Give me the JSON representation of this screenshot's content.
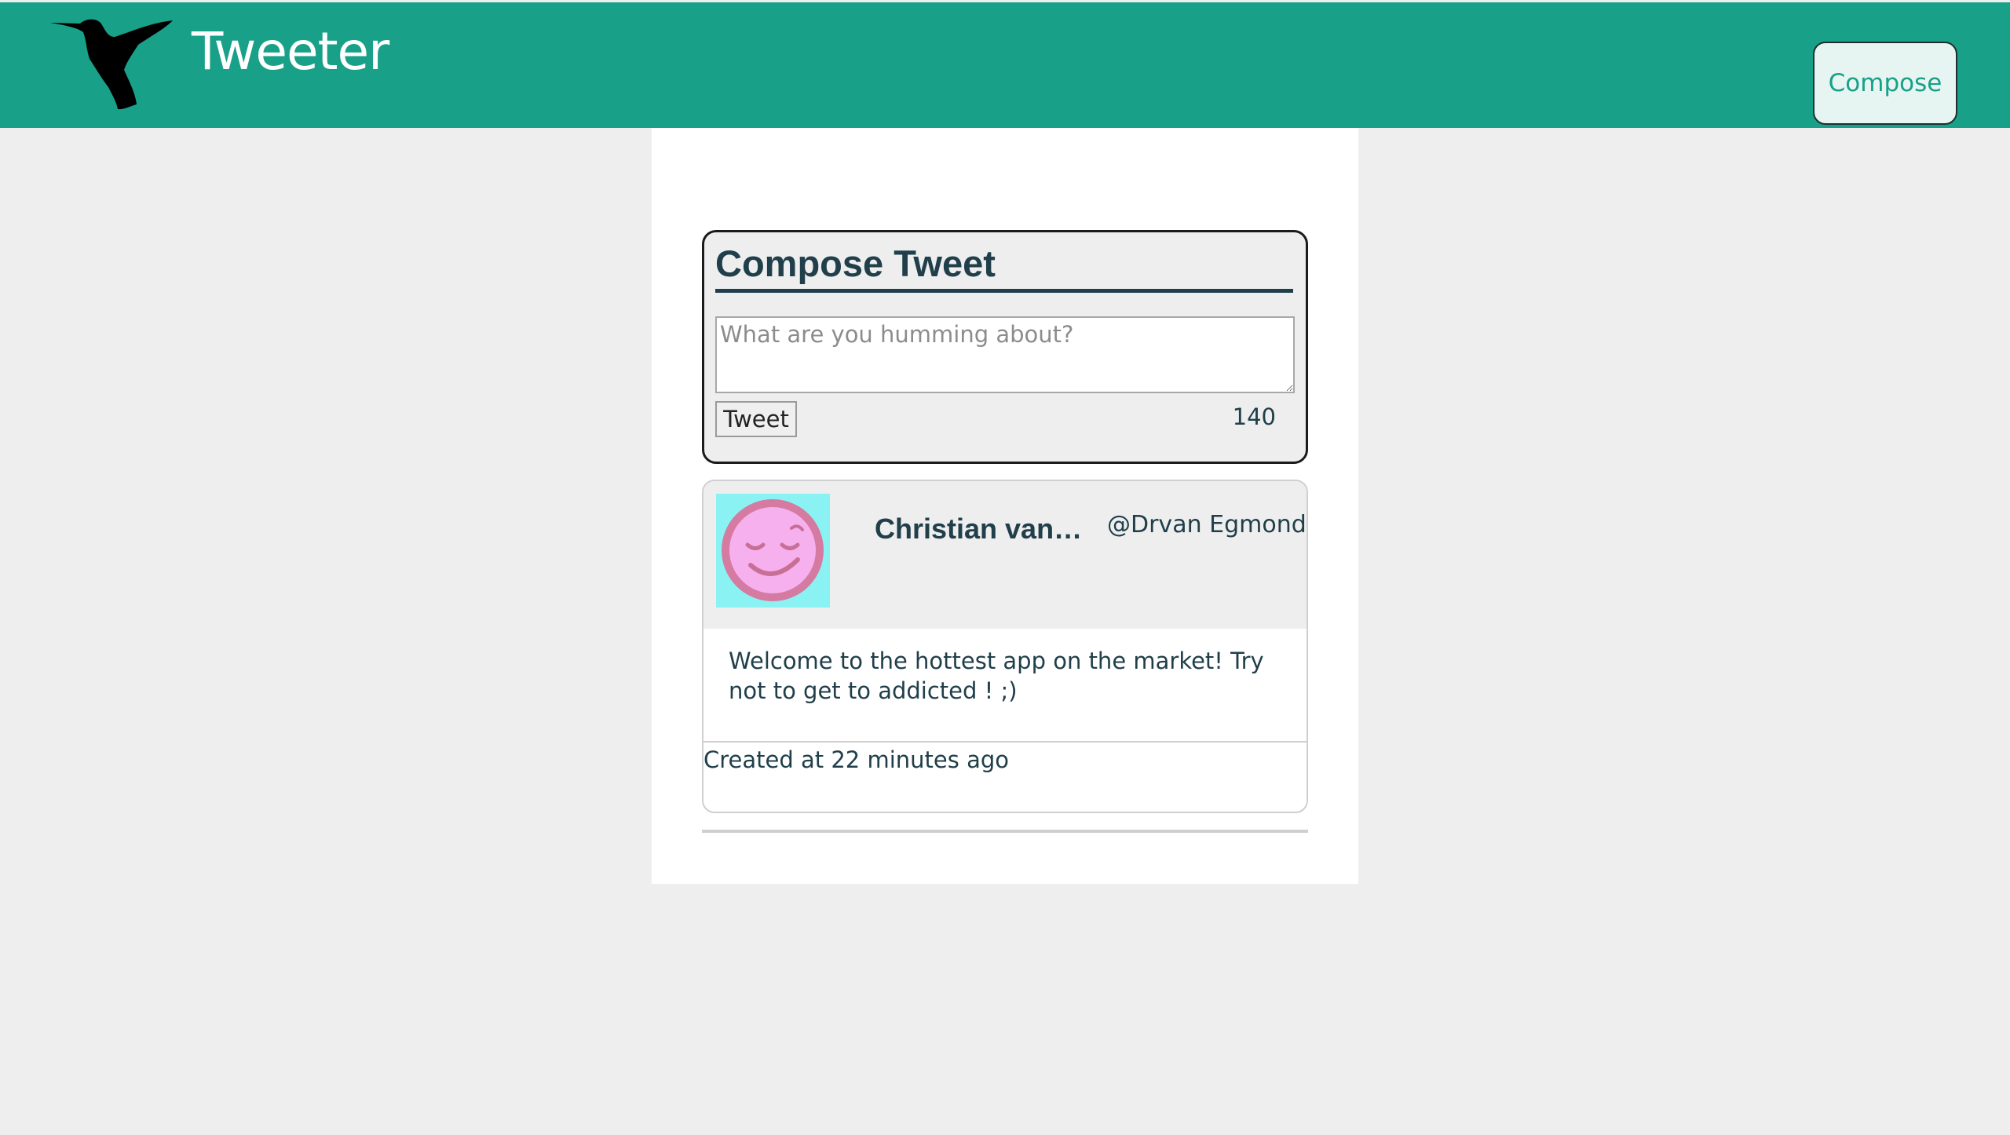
{
  "header": {
    "brand": "Tweeter",
    "logo_icon": "hummingbird-icon",
    "compose_label": "Compose"
  },
  "compose": {
    "title": "Compose Tweet",
    "placeholder": "What are you humming about?",
    "value": "",
    "tweet_button": "Tweet",
    "char_count": "140"
  },
  "tweets": [
    {
      "avatar_icon": "smiley-avatar-icon",
      "name": "Christian van Egmond",
      "handle": "@Drvan Egmond",
      "body": "Welcome to the hottest app on the market! Try not to get to addicted ! ;)",
      "meta": "Created at 22 minutes ago"
    }
  ],
  "colors": {
    "brand": "#18a088",
    "text": "#203f4a",
    "background": "#eeeeee",
    "avatar_bg": "#8af2f2",
    "avatar_face": "#f6b0ee"
  }
}
